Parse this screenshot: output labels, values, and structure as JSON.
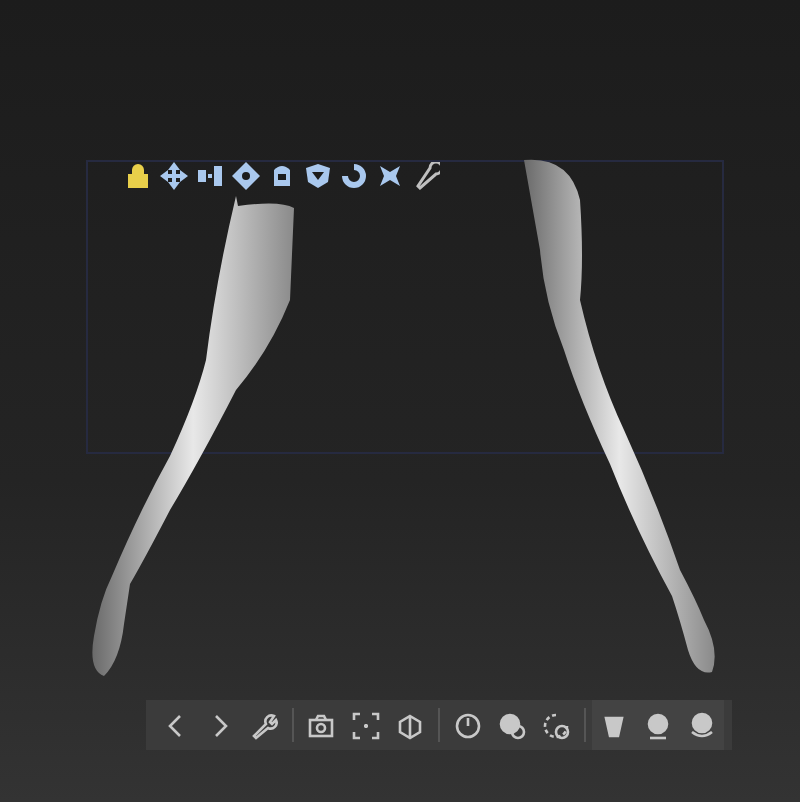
{
  "gizmo_toolbar": [
    {
      "kind": "lock",
      "selected": true
    },
    {
      "kind": "move",
      "selected": false
    },
    {
      "kind": "scale",
      "selected": false
    },
    {
      "kind": "rotate",
      "selected": false
    },
    {
      "kind": "mask",
      "selected": false
    },
    {
      "kind": "polygroup",
      "selected": false
    },
    {
      "kind": "reset",
      "selected": false
    },
    {
      "kind": "customize",
      "selected": false
    },
    {
      "kind": "deformer",
      "selected": false
    }
  ],
  "bottom_toolbar": [
    [
      {
        "kind": "back"
      },
      {
        "kind": "forward"
      },
      {
        "kind": "wrench"
      }
    ],
    [
      {
        "kind": "camera"
      },
      {
        "kind": "frame"
      },
      {
        "kind": "perspective"
      }
    ],
    [
      {
        "kind": "clock"
      },
      {
        "kind": "record"
      },
      {
        "kind": "turntable"
      }
    ],
    [
      {
        "kind": "brush"
      },
      {
        "kind": "sphere"
      },
      {
        "kind": "sphere-hand"
      }
    ]
  ]
}
